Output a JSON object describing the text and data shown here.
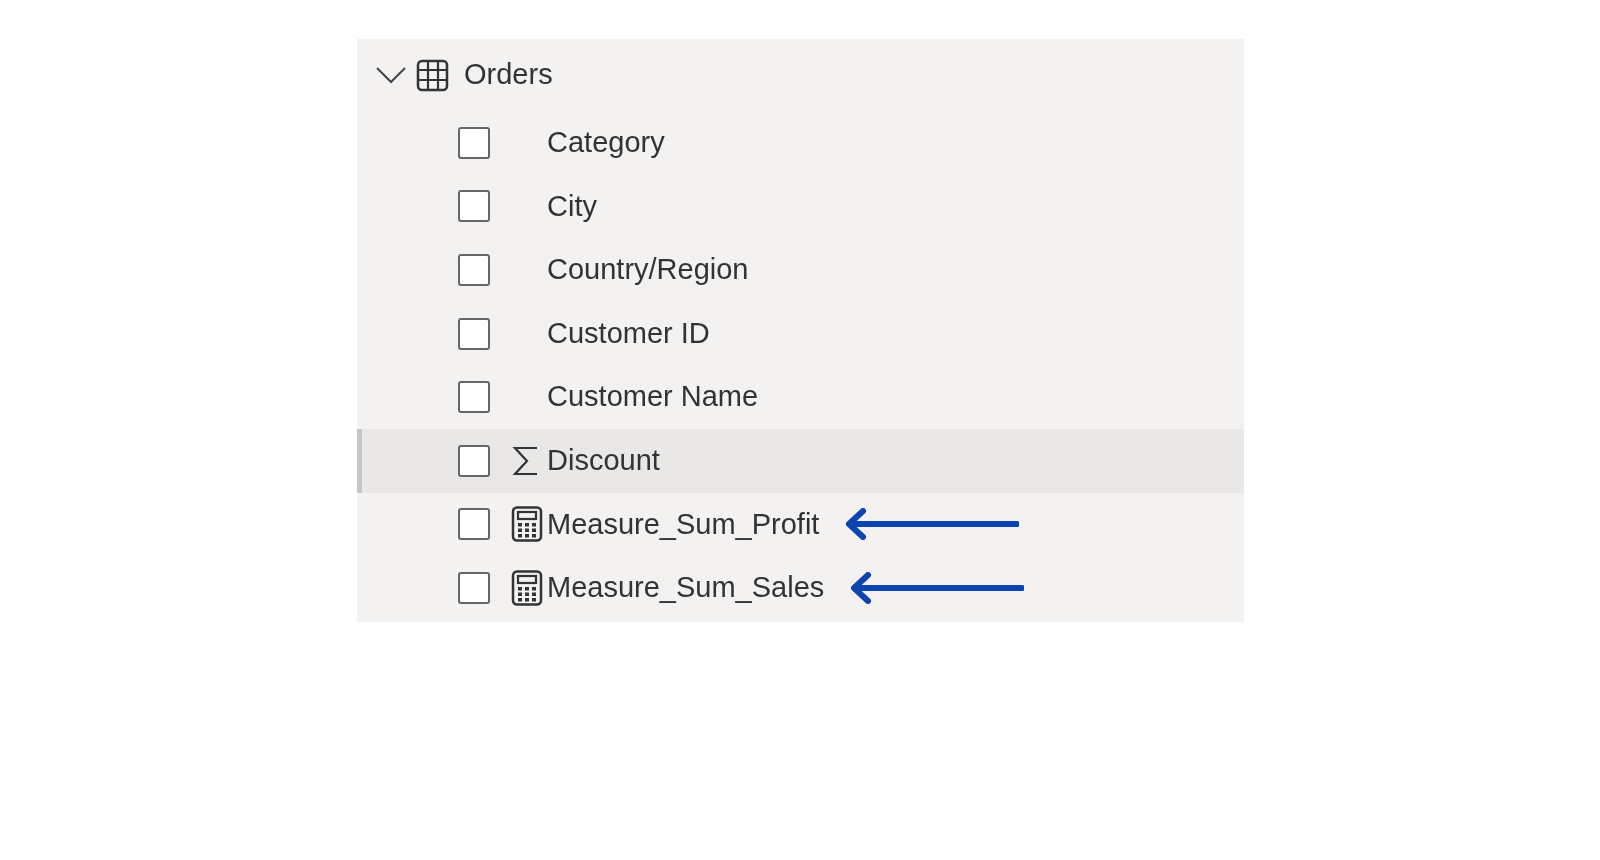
{
  "table": {
    "name": "Orders",
    "expanded": true,
    "fields": [
      {
        "label": "Category",
        "kind": "dimension",
        "checked": false,
        "hovered": false,
        "annotated": false
      },
      {
        "label": "City",
        "kind": "dimension",
        "checked": false,
        "hovered": false,
        "annotated": false
      },
      {
        "label": "Country/Region",
        "kind": "dimension",
        "checked": false,
        "hovered": false,
        "annotated": false
      },
      {
        "label": "Customer ID",
        "kind": "dimension",
        "checked": false,
        "hovered": false,
        "annotated": false
      },
      {
        "label": "Customer Name",
        "kind": "dimension",
        "checked": false,
        "hovered": false,
        "annotated": false
      },
      {
        "label": "Discount",
        "kind": "numeric",
        "checked": false,
        "hovered": true,
        "annotated": false
      },
      {
        "label": "Measure_Sum_Profit",
        "kind": "measure",
        "checked": false,
        "hovered": false,
        "annotated": true
      },
      {
        "label": "Measure_Sum_Sales",
        "kind": "measure",
        "checked": false,
        "hovered": false,
        "annotated": true
      }
    ]
  }
}
